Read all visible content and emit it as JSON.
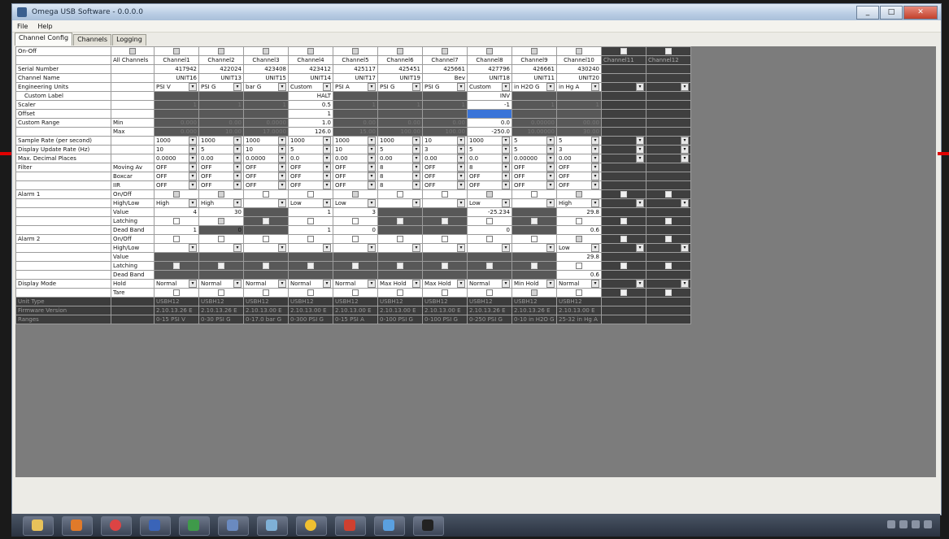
{
  "window": {
    "title": "Omega USB Software - 0.0.0.0"
  },
  "menu": [
    "File",
    "Help"
  ],
  "tabs": [
    "Channel Config",
    "Channels",
    "Logging"
  ],
  "labels": {
    "onoff": "On-Off",
    "serial": "Serial Number",
    "channel_name": "Channel Name",
    "eng_units": "Engineering Units",
    "custom_label": "Custom Label",
    "scaler": "Scaler",
    "offset": "Offset",
    "custom_range": "Custom Range",
    "sample_rate": "Sample Rate (per second)",
    "display_rate": "Display Update Rate (Hz)",
    "max_decimal": "Max. Decimal Places",
    "filter": "Filter",
    "alarm1": "Alarm 1",
    "alarm2": "Alarm 2",
    "display_mode": "Display Mode",
    "unit_type": "Unit Type",
    "firmware": "Firmware Version",
    "ranges": "Ranges"
  },
  "sublabels": {
    "all_channels": "All Channels",
    "min": "Min",
    "max": "Max",
    "moving_av": "Moving Av",
    "boxcar": "Boxcar",
    "iir": "IIR",
    "onoff": "On/Off",
    "highlow": "High/Low",
    "value": "Value",
    "latching": "Latching",
    "deadband": "Dead Band",
    "hold": "Hold",
    "tare": "Tare"
  },
  "channels": [
    "Channel1",
    "Channel2",
    "Channel3",
    "Channel4",
    "Channel5",
    "Channel6",
    "Channel7",
    "Channel8",
    "Channel9",
    "Channel10",
    "Channel11",
    "Channel12"
  ],
  "serials": [
    "417942",
    "422024",
    "423408",
    "423412",
    "425117",
    "425451",
    "425661",
    "427796",
    "426661",
    "430240"
  ],
  "names": [
    "UNIT16",
    "UNIT13",
    "UNIT15",
    "UNIT14",
    "UNIT17",
    "UNIT19",
    "Bev",
    "UNIT18",
    "UNIT11",
    "UNIT20"
  ],
  "units": [
    "PSI V",
    "PSI G",
    "bar G",
    "Custom",
    "PSI A",
    "PSI G",
    "PSI G",
    "Custom",
    "in H2O G",
    "in Hg A"
  ],
  "custom_labels": {
    "c4": "HALT",
    "c8": "INV"
  },
  "scaler": [
    "1",
    "1",
    "1",
    "0.5",
    "1",
    "1",
    "1",
    "-1",
    "1",
    "1"
  ],
  "offset_c4": "1",
  "range_min": [
    "0.000",
    "0.00",
    "0.0000",
    "1.0",
    "0.00",
    "0.00",
    "0.00",
    "0.0",
    "0.00000",
    "00.00"
  ],
  "range_max": [
    "0.000",
    "10.00",
    "17.0000",
    "126.0",
    "15.00",
    "100.00",
    "100.00",
    "-250.0",
    "10.00000",
    "30.00"
  ],
  "sample_rate": [
    "1000",
    "1000",
    "1000",
    "1000",
    "1000",
    "1000",
    "10",
    "1000",
    "5",
    "5"
  ],
  "display_rate": [
    "10",
    "5",
    "10",
    "5",
    "10",
    "5",
    "3",
    "5",
    "5",
    "3"
  ],
  "decimals": [
    "0.0000",
    "0.00",
    "0.0000",
    "0.0",
    "0.00",
    "0.00",
    "0.00",
    "0.0",
    "0.00000",
    "0.00"
  ],
  "filter_moving": [
    "OFF",
    "OFF",
    "OFF",
    "OFF",
    "OFF",
    "8",
    "OFF",
    "8",
    "OFF",
    "OFF"
  ],
  "filter_boxcar": [
    "OFF",
    "OFF",
    "OFF",
    "OFF",
    "OFF",
    "8",
    "OFF",
    "OFF",
    "OFF",
    "OFF"
  ],
  "filter_iir": [
    "OFF",
    "OFF",
    "OFF",
    "OFF",
    "OFF",
    "8",
    "OFF",
    "OFF",
    "OFF",
    "OFF"
  ],
  "alarm1_hl": [
    "High",
    "High",
    "",
    "Low",
    "Low",
    "",
    "",
    "Low",
    "",
    "High"
  ],
  "alarm1_value": [
    "4",
    "30",
    "",
    "1",
    "3",
    "",
    "",
    "-25.234",
    "",
    "29.8"
  ],
  "alarm1_deadband": [
    "1",
    "0",
    "",
    "1",
    "0",
    "",
    "",
    "0",
    "",
    "0.6"
  ],
  "alarm2_hl_c10": "Low",
  "alarm2_value_c10": "29.8",
  "alarm2_deadband_c10": "0.6",
  "display_modes": [
    "Normal",
    "Normal",
    "Normal",
    "Normal",
    "Normal",
    "Max Hold",
    "Max Hold",
    "Normal",
    "Min Hold",
    "Normal"
  ],
  "unit_types": [
    "USBH12",
    "USBH12",
    "USBH12",
    "USBH12",
    "USBH12",
    "USBH12",
    "USBH12",
    "USBH12",
    "USBH12",
    "USBH12"
  ],
  "firmware": [
    "2.10.13.26 E",
    "2.10.13.26 E",
    "2.10.13.00 E",
    "2.10.13.00 E",
    "2.10.13.00 E",
    "2.10.13.00 E",
    "2.10.13.00 E",
    "2.10.13.26 E",
    "2.10.13.26 E",
    "2.10.13.00 E"
  ],
  "ranges": [
    "0-15 PSI V",
    "0-30 PSI G",
    "0-17.0 bar G",
    "0-300 PSI G",
    "0-15 PSI A",
    "0-100 PSI G",
    "0-100 PSI G",
    "0-250 PSI G",
    "0-10 in H2O G",
    "25-32 in Hg A"
  ]
}
